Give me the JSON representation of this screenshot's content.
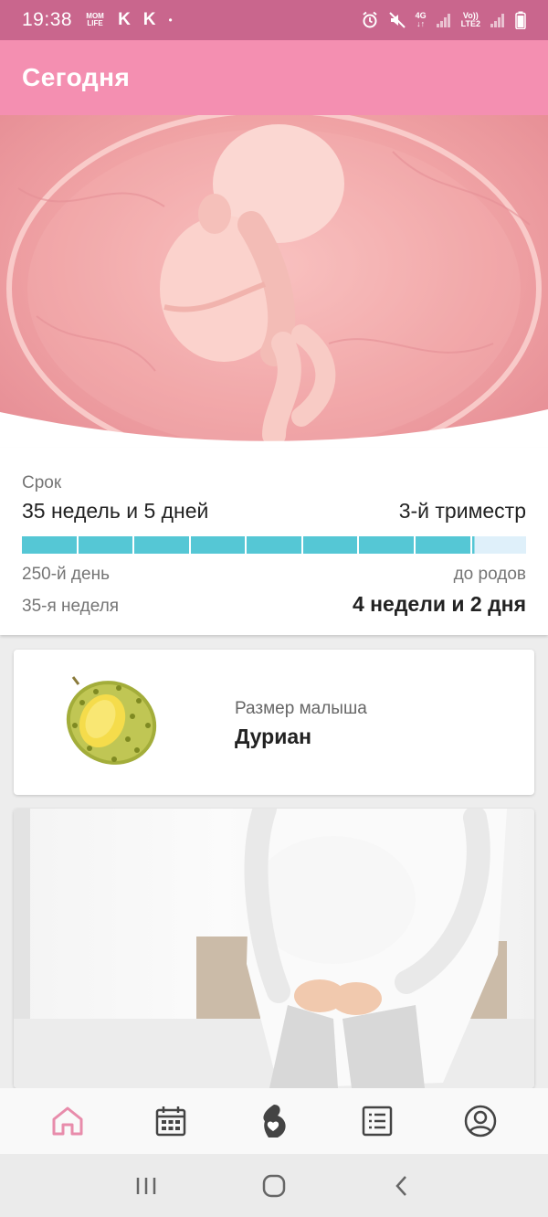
{
  "status_bar": {
    "time": "19:38",
    "mom_life_line1": "MOM",
    "mom_life_line2": "LIFE",
    "k1": "K",
    "k2": "K",
    "dot": "•",
    "network_4g": "4G",
    "volte_line1": "Vo))",
    "volte_line2": "LTE2"
  },
  "header": {
    "title": "Сегодня"
  },
  "term": {
    "label": "Срок",
    "duration": "35 недель и 5 дней",
    "trimester": "3-й триместр",
    "progress_fraction": 0.893,
    "day": "250-й день",
    "until_label": "до родов",
    "week": "35-я неделя",
    "remaining": "4 недели и 2 дня"
  },
  "baby_size": {
    "caption": "Размер малыша",
    "value": "Дуриан",
    "icon": "durian-image"
  },
  "colors": {
    "status_bar": "#c9668d",
    "app_bar": "#f48fb1",
    "progress_fill": "#55c7d5",
    "progress_track": "#dff0fa",
    "active_nav": "#e88cab"
  },
  "bottom_nav": {
    "items": [
      "home-icon",
      "calendar-icon",
      "pregnancy-icon",
      "list-icon",
      "profile-icon"
    ],
    "active": "home-icon"
  },
  "system_nav": {
    "items": [
      "recents-icon",
      "home-button-icon",
      "back-icon"
    ]
  }
}
